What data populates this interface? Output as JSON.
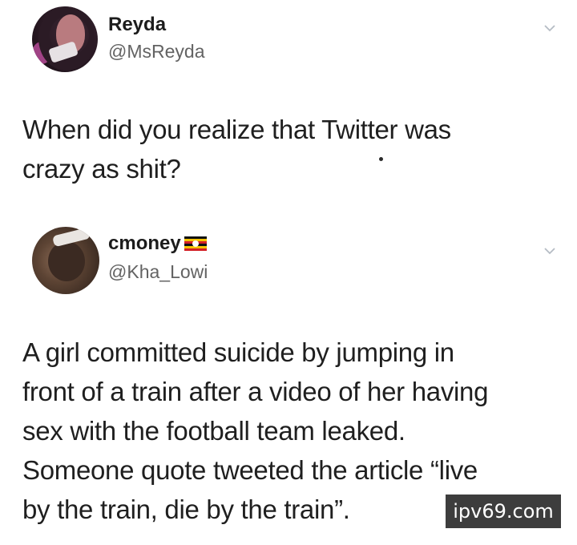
{
  "tweet_1": {
    "display_name": "Reyda",
    "handle": "@MsReyda",
    "text_lines": [
      "When did you realize that Twitter was",
      "crazy as shit?"
    ]
  },
  "tweet_2": {
    "display_name": "cmoney",
    "handle": "@Kha_Lowi",
    "name_badge_icon": "uganda-flag-icon",
    "text_lines": [
      "A girl committed suicide by jumping in",
      "front of a train after a video of her having",
      "sex with the football team leaked.",
      "Someone quote tweeted the article “live",
      "by the train, die by the train”."
    ]
  },
  "watermark": {
    "text": "ipv69.com"
  },
  "colors": {
    "text": "#1f1f1f",
    "handle": "#636363",
    "chevron": "#b5bcc4",
    "watermark_bg": "#3d3d3d"
  }
}
